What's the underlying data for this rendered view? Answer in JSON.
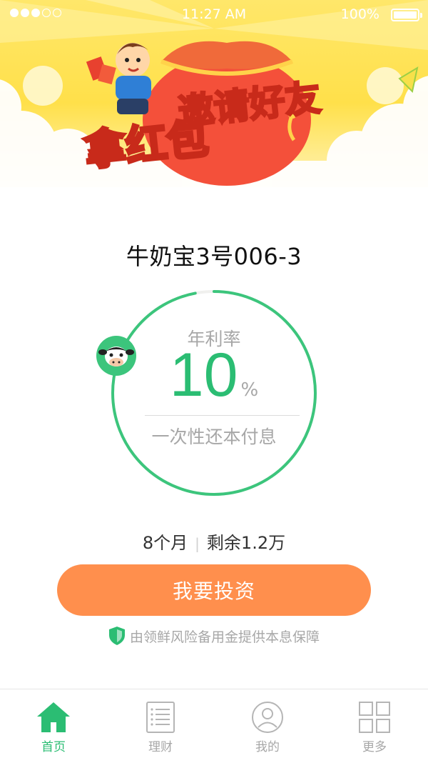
{
  "status_bar": {
    "time": "11:27 AM",
    "battery": "100%",
    "signal_bars_filled": 3,
    "signal_bars_total": 5
  },
  "banner": {
    "line1": "邀请好友",
    "line2": "拿红包"
  },
  "product": {
    "name": "牛奶宝3号006-3",
    "rate_label": "年利率",
    "rate_value": "10",
    "rate_unit": "%",
    "repayment": "一次性还本付息",
    "term": "8个月",
    "remaining": "剩余1.2万",
    "progress_fraction": 0.97
  },
  "action": {
    "invest_label": "我要投资"
  },
  "guarantee": {
    "text": "由领鲜风险备用金提供本息保障",
    "icon": "shield-icon"
  },
  "tabbar": {
    "tabs": [
      {
        "label": "首页",
        "icon": "home-icon",
        "active": true
      },
      {
        "label": "理财",
        "icon": "list-icon",
        "active": false
      },
      {
        "label": "我的",
        "icon": "user-icon",
        "active": false
      },
      {
        "label": "更多",
        "icon": "grid-icon",
        "active": false
      }
    ]
  },
  "colors": {
    "accent_green": "#2bbd73",
    "button_orange": "#ff8f4d",
    "banner_yellow": "#ffe04a",
    "muted_text": "#a7a7a7"
  }
}
